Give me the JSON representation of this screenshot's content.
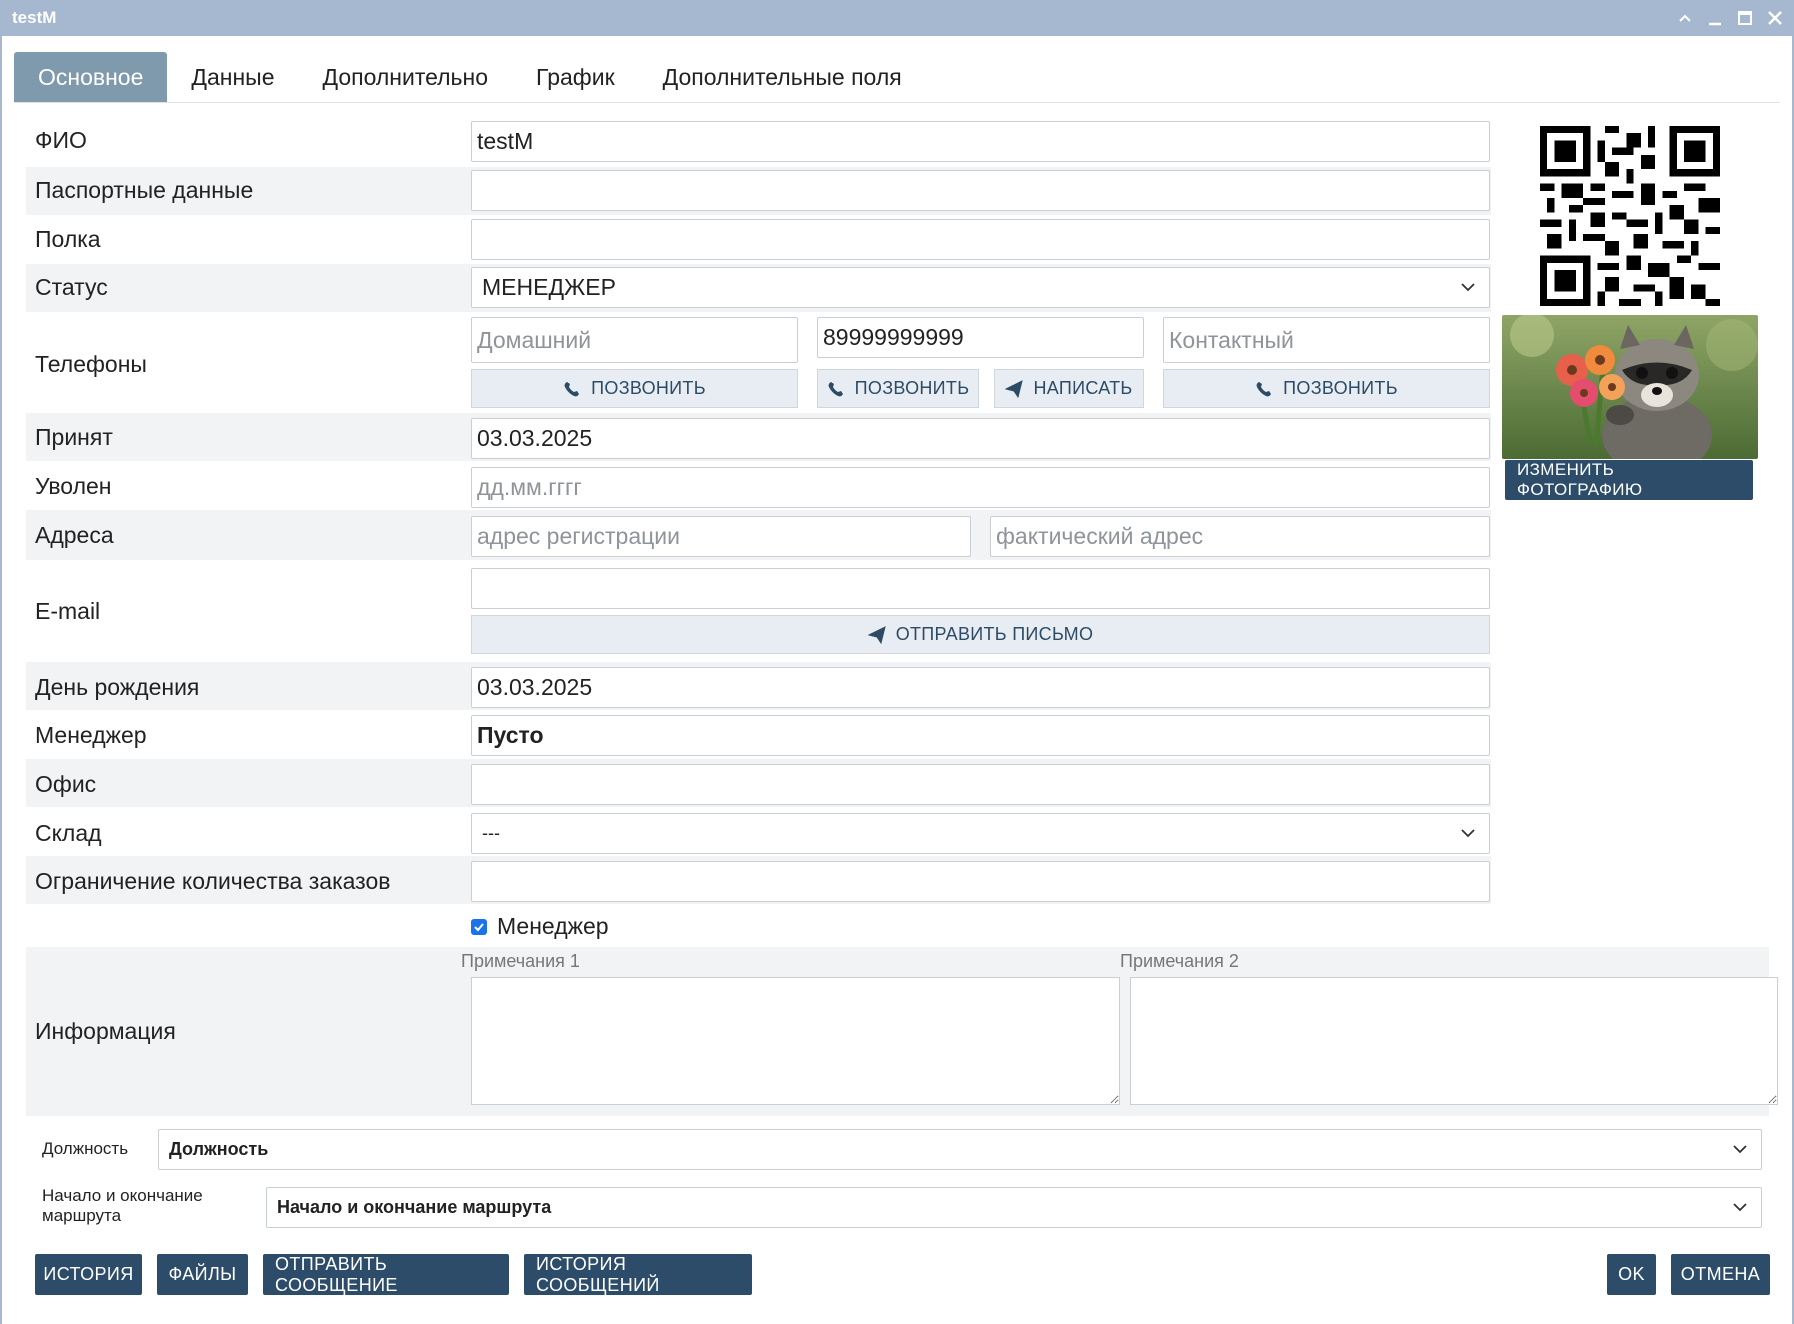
{
  "window": {
    "title": "testM"
  },
  "tabs": [
    "Основное",
    "Данные",
    "Дополнительно",
    "График",
    "Дополнительные поля"
  ],
  "fields": {
    "fio": {
      "label": "ФИО",
      "value": "testM"
    },
    "passport": {
      "label": "Паспортные данные",
      "value": ""
    },
    "shelf": {
      "label": "Полка",
      "value": ""
    },
    "status": {
      "label": "Статус",
      "value": "МЕНЕДЖЕР"
    },
    "phones": {
      "label": "Телефоны",
      "home_placeholder": "Домашний",
      "mobile_value": "89999999999",
      "contact_placeholder": "Контактный",
      "call_label": "ПОЗВОНИТЬ",
      "write_label": "НАПИСАТЬ"
    },
    "hired": {
      "label": "Принят",
      "value": "03.03.2025"
    },
    "fired": {
      "label": "Уволен",
      "placeholder": "дд.мм.гггг"
    },
    "addresses": {
      "label": "Адреса",
      "reg_placeholder": "адрес регистрации",
      "fact_placeholder": "фактический адрес"
    },
    "email": {
      "label": "E-mail",
      "value": "",
      "send_label": "ОТПРАВИТЬ ПИСЬМО"
    },
    "birthday": {
      "label": "День рождения",
      "value": "03.03.2025"
    },
    "manager": {
      "label": "Менеджер",
      "value": "Пусто"
    },
    "office": {
      "label": "Офис",
      "value": ""
    },
    "warehouse": {
      "label": "Склад",
      "value": "---"
    },
    "order_limit": {
      "label": "Ограничение количества заказов",
      "value": ""
    },
    "manager_checkbox": {
      "label": "Менеджер",
      "checked": true
    },
    "info": {
      "label": "Информация",
      "notes1_label": "Примечания 1",
      "notes2_label": "Примечания 2"
    },
    "position": {
      "label": "Должность",
      "value": "Должность"
    },
    "route": {
      "label": "Начало и окончание маршрута",
      "value": "Начало и окончание маршрута"
    }
  },
  "photo": {
    "change_label": "ИЗМЕНИТЬ ФОТОГРАФИЮ"
  },
  "footer": {
    "history": "ИСТОРИЯ",
    "files": "ФАЙЛЫ",
    "send_message": "ОТПРАВИТЬ СООБЩЕНИЕ",
    "message_history": "ИСТОРИЯ СООБЩЕНИЙ",
    "ok": "OK",
    "cancel": "ОТМЕНА"
  },
  "colors": {
    "titlebar": "#a5b8cf",
    "tab_active": "#7f99ad",
    "primary_button": "#2d4c69",
    "light_button": "#e7edf2",
    "row_stripe": "#f1f3f5"
  },
  "icons": {
    "call": "phone-icon",
    "write": "paper-plane-icon",
    "send_mail": "paper-plane-icon",
    "select": "chevron-down-icon"
  }
}
